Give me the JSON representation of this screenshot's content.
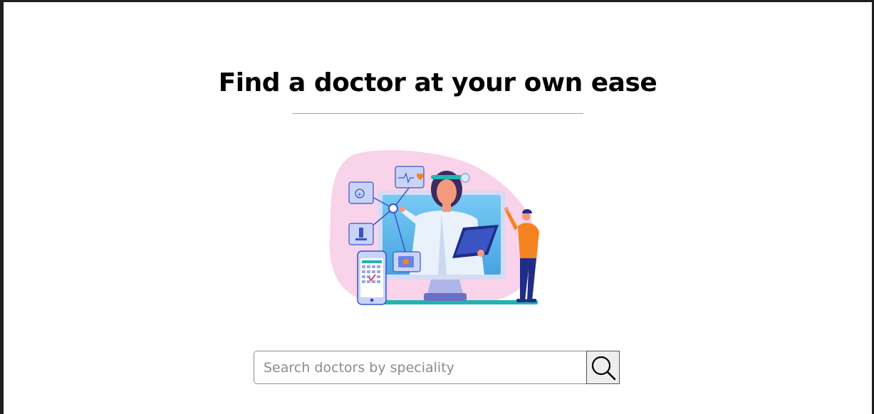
{
  "page": {
    "title": "Find a doctor at your own ease"
  },
  "illustration": {
    "description_icon": "telemedicine-doctor-icon"
  },
  "search": {
    "placeholder": "Search doctors by speciality",
    "value": "",
    "button_icon": "search-icon"
  },
  "colors": {
    "frame": "#1e1e1e",
    "accent_teal": "#1fb5b0",
    "monitor_blue": "#5bbdf0",
    "blob_pink": "#f7d4ea",
    "figure_orange": "#f58220",
    "figure_navy": "#1f2d86"
  }
}
